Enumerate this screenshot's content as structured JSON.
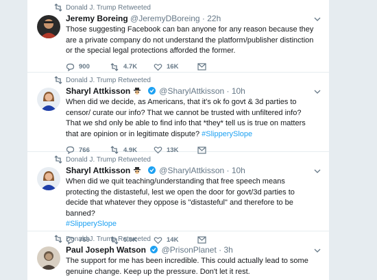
{
  "tweets": [
    {
      "retweet_label": "Donald J. Trump Retweeted",
      "name": "Jeremy Boreing",
      "handle": "@JeremyDBoreing · 22h",
      "verified": false,
      "text": "Those suggesting Facebook can ban anyone for any reason because they are a private company do not understand the platform/publisher distinction or the special legal protections afforded the former.",
      "hashtag": "",
      "replies": "900",
      "retweets": "4.7K",
      "likes": "16K"
    },
    {
      "retweet_label": "Donald J. Trump Retweeted",
      "name": "Sharyl Attkisson",
      "handle": "@SharylAttkisson · 10h",
      "verified": true,
      "text": "When did we decide, as Americans, that it's ok fo govt & 3d parties to censor/ curate our info? That we cannot be trusted with unfiltered info? That we shd only be able to find info that *they* tell us is true on matters that are opinion or in legitimate dispute? ",
      "hashtag": "#SlipperySlope",
      "replies": "766",
      "retweets": "4.9K",
      "likes": "13K"
    },
    {
      "retweet_label": "Donald J. Trump Retweeted",
      "name": "Sharyl Attkisson",
      "handle": "@SharylAttkisson · 10h",
      "verified": true,
      "text": "When did we quit teaching/understanding that free speech means protecting the distasteful, lest we open the door for govt/3d parties to decide that whatever they oppose is \"distasteful\" and therefore to be banned?",
      "hashtag": "#SlipperySlope",
      "replies": "769",
      "retweets": "5.0K",
      "likes": "14K"
    },
    {
      "retweet_label": "Donald J. Trump Retweeted",
      "name": "Paul Joseph Watson",
      "handle": "@PrisonPlanet · 3h",
      "verified": true,
      "text": "The support for me has been incredible. This could actually lead to some genuine change. Keep up the pressure. Don't let it rest.",
      "hashtag": "",
      "replies": "",
      "retweets": "",
      "likes": ""
    }
  ],
  "colors": {
    "accent": "#1da1f2",
    "secondary_text": "#657786",
    "background": "#e6ecf0"
  },
  "icons": [
    "retweet-icon",
    "reply-icon",
    "like-icon",
    "dm-icon",
    "verified-icon",
    "caret-down-icon",
    "detective-emoji-icon"
  ]
}
